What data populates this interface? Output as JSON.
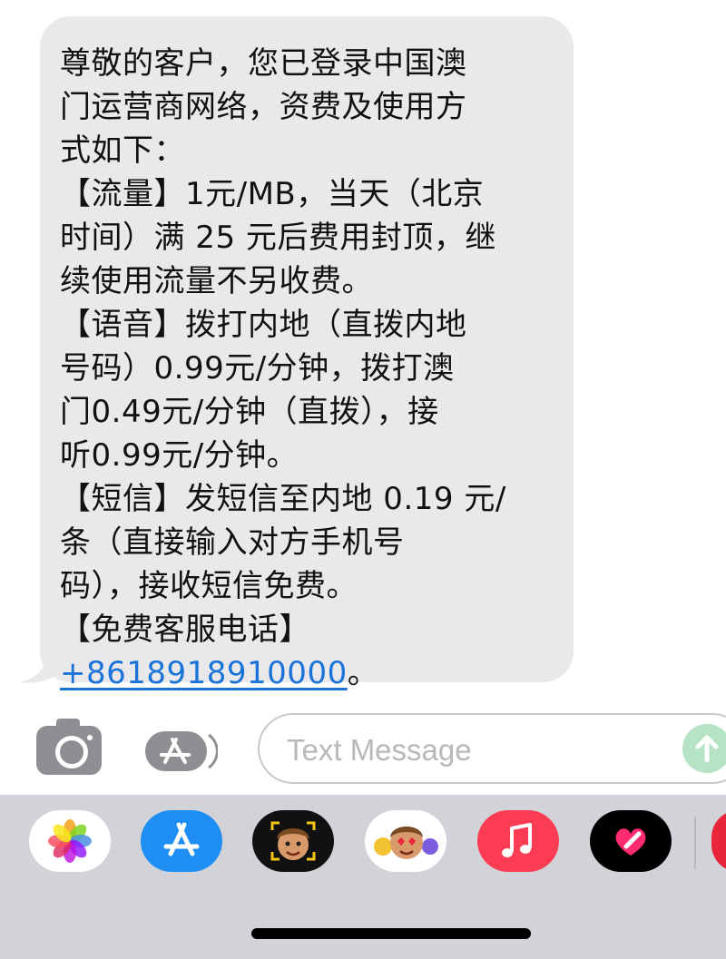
{
  "message": {
    "lines": [
      "尊敬的客户，您已登录中国澳",
      "门运营商网络，资费及使用方",
      "式如下：",
      "【流量】1元/MB，当天（北京",
      "时间）满 25 元后费用封顶，继",
      "续使用流量不另收费。",
      "【语音】拨打内地（直拨内地",
      "号码）0.99元/分钟，拨打澳",
      "门0.49元/分钟（直拨），接",
      "听0.99元/分钟。",
      "【短信】发短信至内地 0.19 元/",
      "条（直接输入对方手机号",
      "码），接收短信免费。",
      "【免费客服电话】"
    ],
    "phone_link": "+8618918910000",
    "phone_suffix": "。"
  },
  "composer": {
    "placeholder": "Text Message",
    "camera_icon": "camera-icon",
    "apps_icon": "app-store-icon",
    "send_icon": "send-arrow-icon"
  },
  "app_drawer": {
    "apps": [
      {
        "name": "photos-icon"
      },
      {
        "name": "app-store-icon"
      },
      {
        "name": "memoji-icon"
      },
      {
        "name": "memoji-stickers-icon"
      },
      {
        "name": "music-icon"
      },
      {
        "name": "digital-touch-icon"
      }
    ]
  },
  "colors": {
    "bubble": "#e9e9eb",
    "link": "#1a73d8",
    "send_button": "#b5e3c4",
    "drawer": "#d1d3d9"
  }
}
